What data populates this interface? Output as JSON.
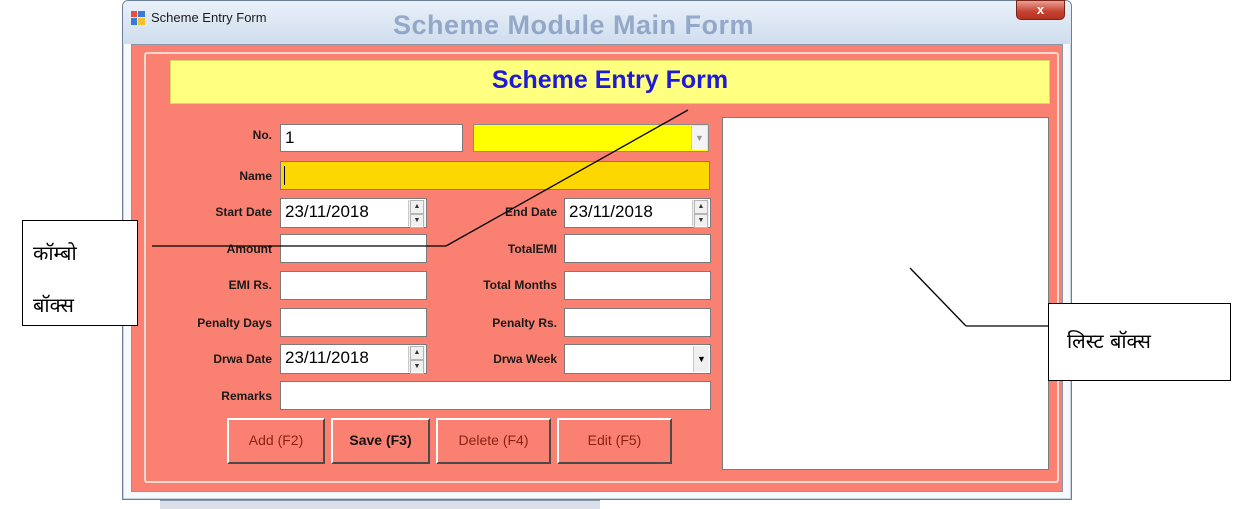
{
  "window": {
    "title": "Scheme Entry Form",
    "background_title": "Scheme Module Main Form",
    "close_glyph": "x"
  },
  "form": {
    "header": "Scheme Entry Form",
    "fields": {
      "no": {
        "label": "No.",
        "value": "1"
      },
      "name": {
        "label": "Name",
        "value": ""
      },
      "start_date": {
        "label": "Start Date",
        "value": "23/11/2018"
      },
      "end_date": {
        "label": "End Date",
        "value": "23/11/2018"
      },
      "amount": {
        "label": "Amount",
        "value": ""
      },
      "total_emi": {
        "label": "TotalEMI",
        "value": ""
      },
      "emi_rs": {
        "label": "EMI Rs.",
        "value": ""
      },
      "total_months": {
        "label": "Total Months",
        "value": ""
      },
      "penalty_days": {
        "label": "Penalty Days",
        "value": ""
      },
      "penalty_rs": {
        "label": "Penalty Rs.",
        "value": ""
      },
      "drwa_date": {
        "label": "Drwa Date",
        "value": "23/11/2018"
      },
      "drwa_week": {
        "label": "Drwa Week",
        "value": ""
      },
      "remarks": {
        "label": "Remarks",
        "value": ""
      }
    },
    "buttons": {
      "add": "Add (F2)",
      "save": "Save (F3)",
      "delete": "Delete (F4)",
      "edit": "Edit (F5)"
    }
  },
  "annotations": {
    "combo_line1": "कॉम्बो",
    "combo_line2": "बॉक्स",
    "listbox": "लिस्ट बॉक्स"
  },
  "colors": {
    "form_bg": "#fa8072",
    "header_bg": "#ffff80",
    "header_text": "#1f19d8",
    "combo_bg": "#ffff00",
    "name_bg": "#ffd700"
  }
}
